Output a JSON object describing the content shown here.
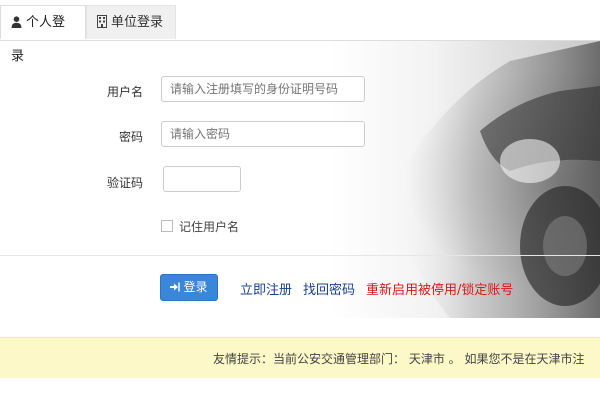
{
  "tabs": [
    {
      "label": "个人登录",
      "icon": "user-icon",
      "active": true
    },
    {
      "label": "单位登录",
      "icon": "building-icon",
      "active": false
    }
  ],
  "form": {
    "username_label": "用户名",
    "username_placeholder": "请输入注册填写的身份证明号码",
    "password_label": "密码",
    "password_placeholder": "请输入密码",
    "captcha_label": "验证码",
    "captcha_value": "",
    "remember_label": "记住用户名"
  },
  "actions": {
    "login_label": "登录",
    "register_label": "立即注册",
    "recover_label": "找回密码",
    "reactivate_label": "重新启用被停用/锁定账号"
  },
  "notice": {
    "text": "友情提示：当前公安交通管理部门：  天津市 。 如果您不是在天津市注"
  },
  "colors": {
    "accent": "#3a86d9",
    "link": "#1a3f8f",
    "alert_link": "#e0151b",
    "notice_bg": "#fcf8c7"
  }
}
